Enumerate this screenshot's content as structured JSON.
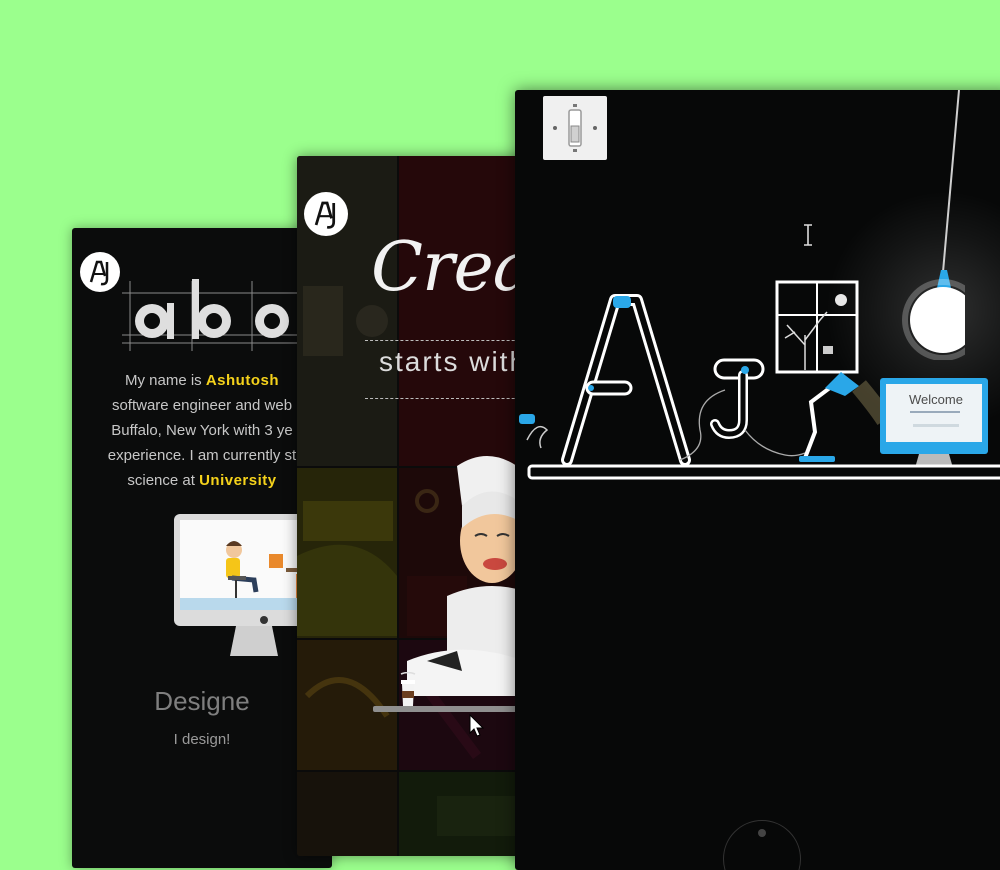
{
  "about": {
    "title": "abou",
    "lines": [
      [
        "My name is ",
        "Ashutosh",
        ""
      ],
      [
        "software engineer and web",
        "",
        ""
      ],
      [
        "Buffalo, New York with 3 ye",
        "",
        ""
      ],
      [
        "experience. I am currently st",
        "",
        ""
      ],
      [
        "science at ",
        "University",
        ""
      ]
    ],
    "designer_heading": "Designe",
    "designer_sub": "I design!"
  },
  "creat": {
    "title": "Creat",
    "subtitle": "starts with"
  },
  "main": {
    "welcome": "Welcome"
  },
  "colors": {
    "background": "#9bff8d",
    "accent_yellow": "#f5d21b",
    "accent_blue": "#2aa7e8",
    "dark": "#070808"
  },
  "icons": {
    "logo": "aj-logo-icon",
    "switch": "light-switch-icon",
    "cursor_text": "text-cursor-icon",
    "cursor_pointer": "pointer-cursor-icon"
  }
}
